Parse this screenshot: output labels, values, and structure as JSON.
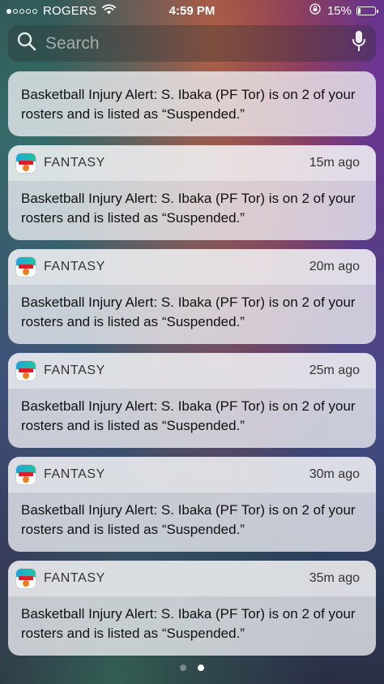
{
  "status_bar": {
    "carrier": "ROGERS",
    "signal_bars_filled": 1,
    "signal_bars_total": 5,
    "time": "4:59 PM",
    "battery_percent": "15%",
    "battery_level": 0.15,
    "icons": [
      "wifi-icon",
      "rotation-lock-icon",
      "battery-icon"
    ]
  },
  "search": {
    "placeholder": "Search",
    "icons": [
      "search-icon",
      "microphone-icon"
    ]
  },
  "partial_notification": {
    "body": "Basketball Injury Alert: S. Ibaka (PF Tor) is on 2 of your rosters and is listed as “Suspended.”"
  },
  "notifications": [
    {
      "app": "FANTASY",
      "time_ago": "15m ago",
      "body": "Basketball Injury Alert: S. Ibaka (PF Tor) is on 2 of your rosters and is listed as “Suspended.”"
    },
    {
      "app": "FANTASY",
      "time_ago": "20m ago",
      "body": "Basketball Injury Alert: S. Ibaka (PF Tor) is on 2 of your rosters and is listed as “Suspended.”"
    },
    {
      "app": "FANTASY",
      "time_ago": "25m ago",
      "body": "Basketball Injury Alert: S. Ibaka (PF Tor) is on 2 of your rosters and is listed as “Suspended.”"
    },
    {
      "app": "FANTASY",
      "time_ago": "30m ago",
      "body": "Basketball Injury Alert: S. Ibaka (PF Tor) is on 2 of your rosters and is listed as “Suspended.”"
    },
    {
      "app": "FANTASY",
      "time_ago": "35m ago",
      "body": "Basketball Injury Alert: S. Ibaka (PF Tor) is on 2 of your rosters and is listed as “Suspended.”"
    }
  ],
  "page_indicator": {
    "pages": 2,
    "current": 2
  },
  "colors": {
    "card_background": "#f0f0f4",
    "text": "#111111",
    "secondary_text": "#333333"
  }
}
